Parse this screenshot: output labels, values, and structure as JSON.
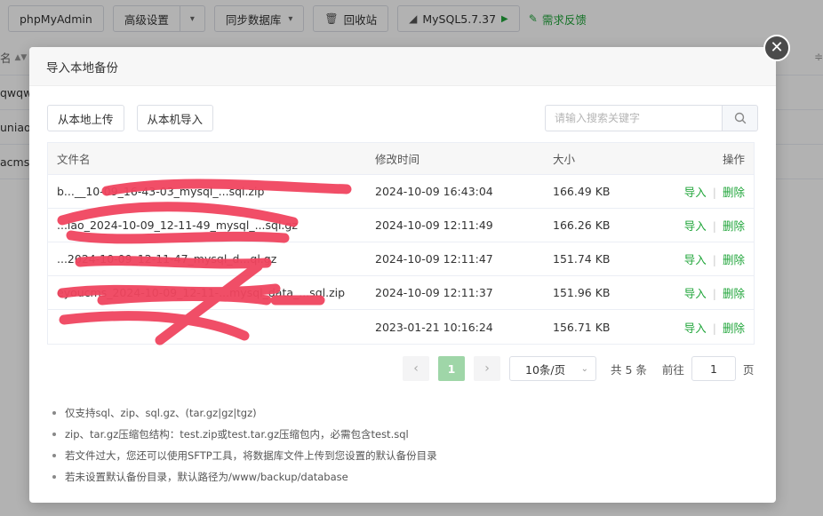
{
  "toolbar": {
    "phpmyadmin": "phpMyAdmin",
    "advanced": "高级设置",
    "sync": "同步数据库",
    "recycle": "回收站",
    "mysql": "MySQL5.7.37",
    "feedback": "需求反馈"
  },
  "bg_table": {
    "head": "名",
    "rows": [
      "qwqw",
      "uniao",
      "acms"
    ]
  },
  "modal": {
    "title": "导入本地备份",
    "upload_local": "从本地上传",
    "import_machine": "从本机导入",
    "search_placeholder": "请输入搜索关键字",
    "columns": {
      "name": "文件名",
      "time": "修改时间",
      "size": "大小",
      "ops": "操作"
    },
    "files": [
      {
        "name": "b...__10-09_16-43-03_mysql_...sql.zip",
        "time": "2024-10-09 16:43:04",
        "size": "166.49 KB"
      },
      {
        "name": "...iao_2024-10-09_12-11-49_mysql_...sql.gz",
        "time": "2024-10-09 12:11:49",
        "size": "166.26 KB"
      },
      {
        "name": "...2024-10-09_12-11-47_mysql_d...ql.gz",
        "time": "2024-10-09 12:11:47",
        "size": "151.74 KB"
      },
      {
        "name": "eyoucms_2024-10-09_12-11-...mysql_data_...sql.zip",
        "time": "2024-10-09 12:11:37",
        "size": "151.96 KB"
      },
      {
        "name": "",
        "time": "2023-01-21 10:16:24",
        "size": "156.71 KB"
      }
    ],
    "op_import": "导入",
    "op_delete": "删除",
    "pagination": {
      "prev": "‹",
      "current": "1",
      "next": "›",
      "page_size": "10条/页",
      "total": "共 5 条",
      "goto": "前往",
      "goto_value": "1",
      "page_unit": "页"
    },
    "notes": [
      "仅支持sql、zip、sql.gz、(tar.gz|gz|tgz)",
      "zip、tar.gz压缩包结构：test.zip或test.tar.gz压缩包内，必需包含test.sql",
      "若文件过大，您还可以使用SFTP工具，将数据库文件上传到您设置的默认备份目录",
      "若未设置默认备份目录，默认路径为/www/backup/database"
    ]
  },
  "colors": {
    "accent": "#20a53a",
    "scribble": "#f0455f"
  }
}
